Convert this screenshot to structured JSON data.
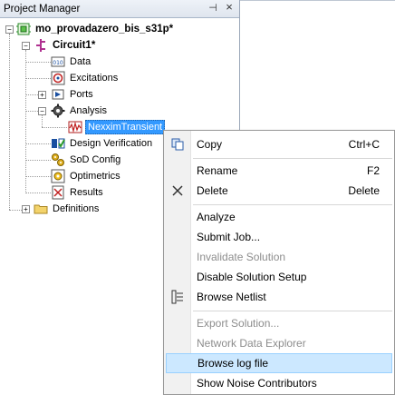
{
  "panel": {
    "title": "Project Manager",
    "pin_glyph": "⊣",
    "close_glyph": "×"
  },
  "tree": {
    "project": "mo_provadazero_bis_s31p*",
    "circuit": "Circuit1*",
    "data": "Data",
    "excitations": "Excitations",
    "ports": "Ports",
    "analysis": "Analysis",
    "setup": "NexximTransient",
    "design_verification": "Design Verification",
    "sod_config": "SoD Config",
    "optimetrics": "Optimetrics",
    "results": "Results",
    "definitions": "Definitions"
  },
  "menu": {
    "copy": "Copy",
    "copy_shortcut": "Ctrl+C",
    "rename": "Rename",
    "rename_shortcut": "F2",
    "delete": "Delete",
    "delete_shortcut": "Delete",
    "analyze": "Analyze",
    "submit_job": "Submit Job...",
    "invalidate_solution": "Invalidate Solution",
    "disable_setup": "Disable Solution Setup",
    "browse_netlist": "Browse Netlist",
    "export_solution": "Export Solution...",
    "network_data_explorer": "Network Data Explorer",
    "browse_log": "Browse log file",
    "show_noise": "Show Noise Contributors"
  },
  "colors": {
    "selection": "#3399ff",
    "menu_highlight": "#cce8ff",
    "disabled_text": "#8d8d8d"
  }
}
